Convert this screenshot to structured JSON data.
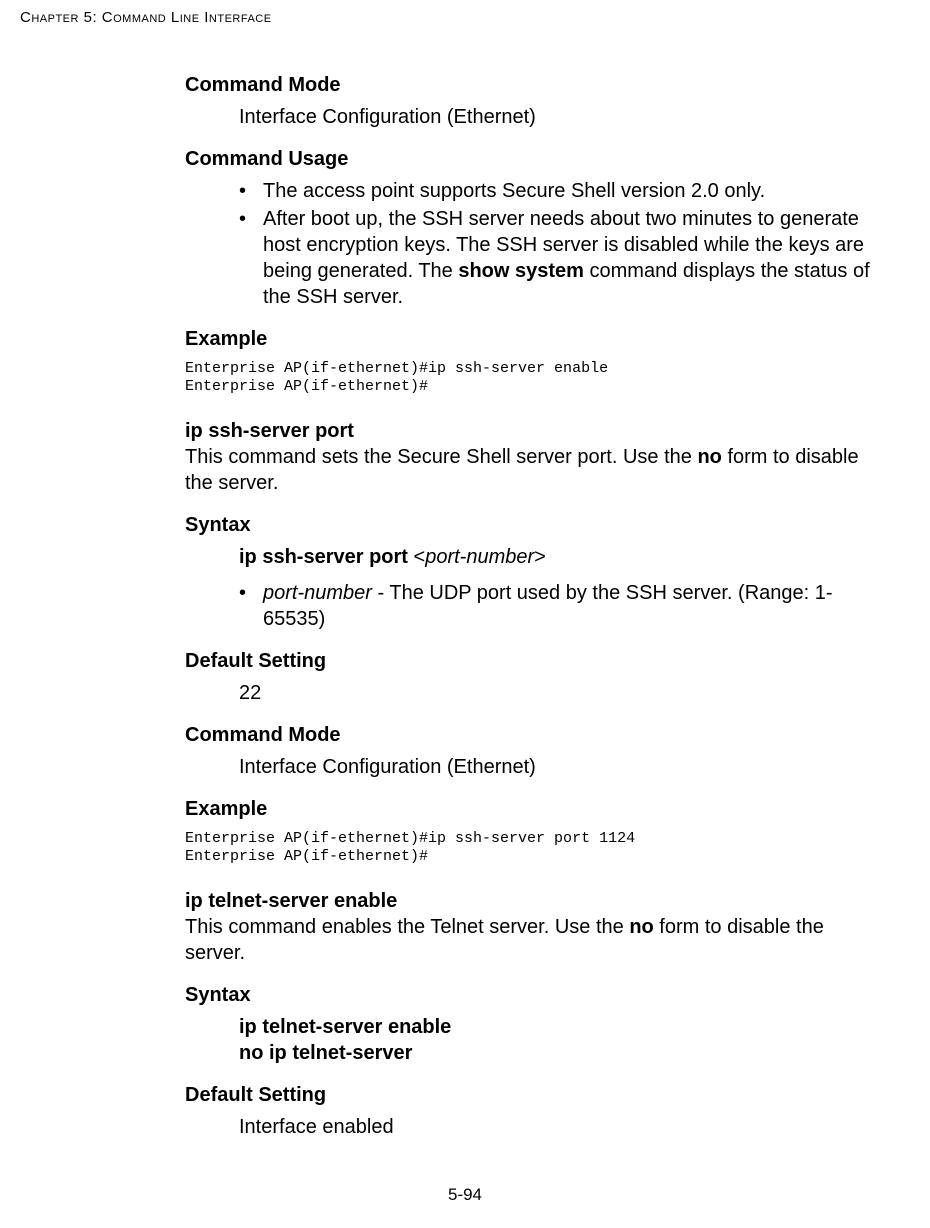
{
  "running_head": "Chapter 5: Command Line Interface",
  "page_number": "5-94",
  "s1": {
    "h_mode": "Command Mode",
    "mode": "Interface Configuration (Ethernet)",
    "h_usage": "Command Usage",
    "usage_b1": "The access point supports Secure Shell version 2.0 only.",
    "usage_b2_a": "After boot up, the SSH server needs about two minutes to generate host encryption keys. The SSH server is disabled while the keys are being generated. The ",
    "usage_b2_bold": "show system",
    "usage_b2_b": " command displays the status of the SSH server.",
    "h_example": "Example",
    "code": "Enterprise AP(if-ethernet)#ip ssh-server enable\nEnterprise AP(if-ethernet)#"
  },
  "s2": {
    "title": "ip ssh-server port",
    "desc_a": "This command sets the Secure Shell server port. Use the ",
    "desc_bold": "no",
    "desc_b": " form to disable the server.",
    "h_syntax": "Syntax",
    "syntax_bold": "ip ssh-server port",
    "syntax_open": " <",
    "syntax_ital": "port-number",
    "syntax_close": ">",
    "param_ital": "port-number",
    "param_rest": " - The UDP port used by the SSH server. (Range: 1-65535)",
    "h_default": "Default Setting",
    "default_val": "22",
    "h_mode": "Command Mode",
    "mode": "Interface Configuration (Ethernet)",
    "h_example": "Example",
    "code": "Enterprise AP(if-ethernet)#ip ssh-server port 1124\nEnterprise AP(if-ethernet)#"
  },
  "s3": {
    "title": "ip telnet-server enable",
    "desc_a": "This command enables the Telnet server. Use the ",
    "desc_bold": "no",
    "desc_b": " form to disable the server.",
    "h_syntax": "Syntax",
    "syntax_l1": "ip telnet-server enable",
    "syntax_l2": "no ip telnet-server",
    "h_default": "Default Setting",
    "default_val": "Interface enabled"
  }
}
